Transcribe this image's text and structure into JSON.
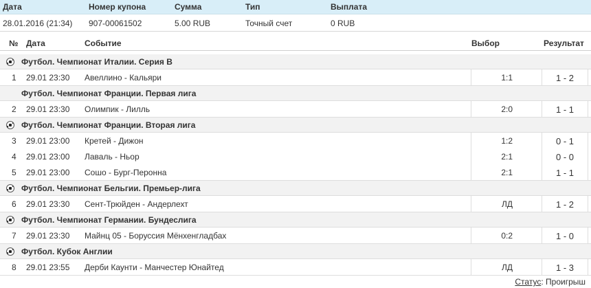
{
  "coupon": {
    "headers": {
      "date": "Дата",
      "number": "Номер купона",
      "amount": "Сумма",
      "type": "Тип",
      "payout": "Выплата"
    },
    "values": {
      "date": "28.01.2016 (21:34)",
      "number": "907-00061502",
      "amount": "5.00 RUB",
      "type": "Точный счет",
      "payout": "0 RUB"
    }
  },
  "events_header": {
    "no": "№",
    "date": "Дата",
    "event": "Событие",
    "pick": "Выбор",
    "result": "Результат"
  },
  "groups": [
    {
      "title": "Футбол. Чемпионат Италии. Серия B",
      "icon": "soccer-ball-icon",
      "rows": [
        {
          "no": "1",
          "date": "29.01 23:30",
          "event": "Авеллино - Кальяри",
          "pick": "1:1",
          "result": "1 - 2"
        }
      ]
    },
    {
      "title": "Футбол. Чемпионат Франции. Первая лига",
      "icon": "soccer-ball-icon",
      "rows": [
        {
          "no": "2",
          "date": "29.01 23:30",
          "event": "Олимпик - Лилль",
          "pick": "2:0",
          "result": "1 - 1"
        }
      ]
    },
    {
      "title": "Футбол. Чемпионат Франции. Вторая лига",
      "icon": "soccer-ball-icon",
      "rows": [
        {
          "no": "3",
          "date": "29.01 23:00",
          "event": "Кретей - Дижон",
          "pick": "1:2",
          "result": "0 - 1"
        },
        {
          "no": "4",
          "date": "29.01 23:00",
          "event": "Лаваль - Ньор",
          "pick": "2:1",
          "result": "0 - 0"
        },
        {
          "no": "5",
          "date": "29.01 23:00",
          "event": "Сошо - Бург-Перонна",
          "pick": "2:1",
          "result": "1 - 1"
        }
      ]
    },
    {
      "title": "Футбол. Чемпионат Бельгии. Премьер-лига",
      "icon": "soccer-ball-icon",
      "rows": [
        {
          "no": "6",
          "date": "29.01 23:30",
          "event": "Сент-Трюйден - Андерлехт",
          "pick": "ЛД",
          "result": "1 - 2"
        }
      ]
    },
    {
      "title": "Футбол. Чемпионат Германии. Бундеслига",
      "icon": "soccer-ball-icon",
      "rows": [
        {
          "no": "7",
          "date": "29.01 23:30",
          "event": "Майнц 05 - Боруссия Мёнхенгладбах",
          "pick": "0:2",
          "result": "1 - 0"
        }
      ]
    },
    {
      "title": "Футбол. Кубок Англии",
      "icon": "soccer-ball-icon",
      "rows": [
        {
          "no": "8",
          "date": "29.01 23:55",
          "event": "Дерби Каунти - Манчестер Юнайтед",
          "pick": "ЛД",
          "result": "1 - 3"
        }
      ]
    }
  ],
  "status": {
    "label": "Статус",
    "separator": ":",
    "value": "Проигрыш"
  },
  "colors": {
    "header_bg": "#d8eef8",
    "group_bg": "#f2f2f2",
    "border": "#dddddd"
  }
}
